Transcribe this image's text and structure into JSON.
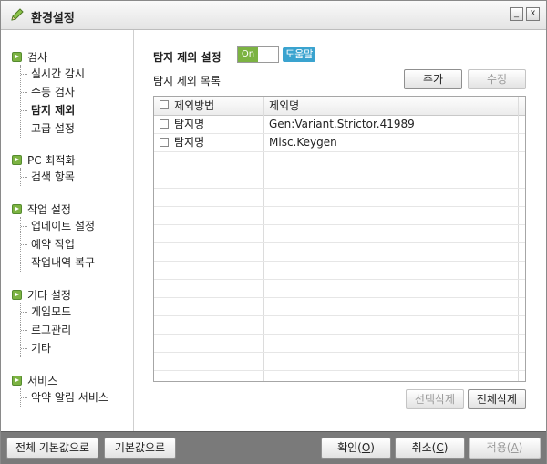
{
  "window": {
    "title": "환경설정",
    "minimize_label": "_",
    "close_label": "x"
  },
  "sidebar": {
    "groups": [
      {
        "label": "검사",
        "items": [
          "실시간 감시",
          "수동 검사",
          "탐지 제외",
          "고급 설정"
        ]
      },
      {
        "label": "PC 최적화",
        "items": [
          "검색 항목"
        ]
      },
      {
        "label": "작업 설정",
        "items": [
          "업데이트 설정",
          "예약 작업",
          "작업내역 복구"
        ]
      },
      {
        "label": "기타 설정",
        "items": [
          "게임모드",
          "로그관리",
          "기타"
        ]
      },
      {
        "label": "서비스",
        "items": [
          "악약 알림 서비스"
        ]
      }
    ],
    "active_item": "탐지 제외"
  },
  "main": {
    "section_title": "탐지 제외 설정",
    "toggle_label": "On",
    "help_label": "도움말",
    "list_label": "탐지 제외 목록",
    "add_button": "추가",
    "edit_button": "수정",
    "table": {
      "columns": [
        "제외방법",
        "제외명"
      ],
      "rows": [
        [
          "탐지명",
          "Gen:Variant.Strictor.41989"
        ],
        [
          "탐지명",
          "Misc.Keygen"
        ]
      ]
    },
    "delete_selected_button": "선택삭제",
    "delete_all_button": "전체삭제"
  },
  "footer": {
    "reset_all_button": "전체 기본값으로",
    "reset_button": "기본값으로",
    "ok_button": "확인",
    "ok_key": "O",
    "cancel_button": "취소",
    "cancel_key": "C",
    "apply_button": "적용",
    "apply_key": "A"
  },
  "colors": {
    "accent_green": "#7cb342",
    "help_blue": "#3aa3cf",
    "footer_gray": "#7a7a7a"
  }
}
